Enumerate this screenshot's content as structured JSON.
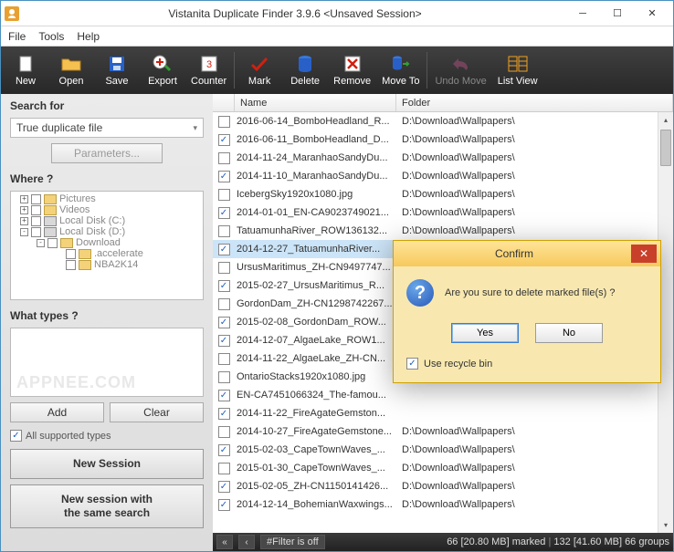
{
  "title": "Vistanita Duplicate Finder 3.9.6 <Unsaved Session>",
  "menu": {
    "file": "File",
    "tools": "Tools",
    "help": "Help"
  },
  "toolbar": [
    {
      "label": "New",
      "icon": "new",
      "color": "#ffffff"
    },
    {
      "label": "Open",
      "icon": "open",
      "color": "#f0b030"
    },
    {
      "label": "Save",
      "icon": "save",
      "color": "#2060d0"
    },
    {
      "label": "Export",
      "icon": "export",
      "color": "#e84020"
    },
    {
      "label": "Counter",
      "icon": "counter",
      "color": "#ffffff"
    },
    {
      "label": "Mark",
      "icon": "mark",
      "color": "#d02010"
    },
    {
      "label": "Delete",
      "icon": "delete",
      "color": "#2060d0"
    },
    {
      "label": "Remove",
      "icon": "remove",
      "color": "#e03020"
    },
    {
      "label": "Move To",
      "icon": "moveto",
      "color": "#2060d0"
    },
    {
      "label": "Undo Move",
      "icon": "undo",
      "color": "#b05080",
      "disabled": true
    },
    {
      "label": "List View",
      "icon": "listview",
      "color": "#f0a020"
    }
  ],
  "sidebar": {
    "search_for": "Search for",
    "search_type": "True duplicate file",
    "parameters": "Parameters...",
    "where": "Where ?",
    "tree": [
      {
        "indent": 0,
        "toggle": "+",
        "label": "Pictures",
        "type": "folder"
      },
      {
        "indent": 0,
        "toggle": "+",
        "label": "Videos",
        "type": "folder"
      },
      {
        "indent": 0,
        "toggle": "+",
        "label": "Local Disk (C:)",
        "type": "drive"
      },
      {
        "indent": 0,
        "toggle": "-",
        "label": "Local Disk (D:)",
        "type": "drive"
      },
      {
        "indent": 1,
        "toggle": "-",
        "label": "Download",
        "type": "folder"
      },
      {
        "indent": 2,
        "toggle": "",
        "label": ".accelerate",
        "type": "folder"
      },
      {
        "indent": 2,
        "toggle": "",
        "label": "NBA2K14",
        "type": "folder"
      }
    ],
    "what_types": "What types ?",
    "watermark": "APPNEE.COM",
    "add": "Add",
    "clear": "Clear",
    "all_types": "All supported types",
    "new_session": "New Session",
    "new_session_same": "New session with\nthe same search"
  },
  "columns": {
    "name": "Name",
    "folder": "Folder"
  },
  "rows": [
    {
      "checked": false,
      "name": "2016-06-14_BomboHeadland_R...",
      "folder": "D:\\Download\\Wallpapers\\"
    },
    {
      "checked": true,
      "name": "2016-06-11_BomboHeadland_D...",
      "folder": "D:\\Download\\Wallpapers\\"
    },
    {
      "checked": false,
      "name": "2014-11-24_MaranhaoSandyDu...",
      "folder": "D:\\Download\\Wallpapers\\"
    },
    {
      "checked": true,
      "name": "2014-11-10_MaranhaoSandyDu...",
      "folder": "D:\\Download\\Wallpapers\\"
    },
    {
      "checked": false,
      "name": "IcebergSky1920x1080.jpg",
      "folder": "D:\\Download\\Wallpapers\\"
    },
    {
      "checked": true,
      "name": "2014-01-01_EN-CA9023749021...",
      "folder": "D:\\Download\\Wallpapers\\"
    },
    {
      "checked": false,
      "name": "TatuamunhaRiver_ROW136132...",
      "folder": "D:\\Download\\Wallpapers\\"
    },
    {
      "checked": true,
      "name": "2014-12-27_TatuamunhaRiver...",
      "folder": "",
      "sel": true
    },
    {
      "checked": false,
      "name": "UrsusMaritimus_ZH-CN9497747...",
      "folder": ""
    },
    {
      "checked": true,
      "name": "2015-02-27_UrsusMaritimus_R...",
      "folder": ""
    },
    {
      "checked": false,
      "name": "GordonDam_ZH-CN1298742267...",
      "folder": ""
    },
    {
      "checked": true,
      "name": "2015-02-08_GordonDam_ROW...",
      "folder": ""
    },
    {
      "checked": true,
      "name": "2014-12-07_AlgaeLake_ROW1...",
      "folder": ""
    },
    {
      "checked": false,
      "name": "2014-11-22_AlgaeLake_ZH-CN...",
      "folder": ""
    },
    {
      "checked": false,
      "name": "OntarioStacks1920x1080.jpg",
      "folder": ""
    },
    {
      "checked": true,
      "name": "EN-CA7451066324_The-famou...",
      "folder": ""
    },
    {
      "checked": true,
      "name": "2014-11-22_FireAgateGemston...",
      "folder": ""
    },
    {
      "checked": false,
      "name": "2014-10-27_FireAgateGemstone...",
      "folder": "D:\\Download\\Wallpapers\\"
    },
    {
      "checked": true,
      "name": "2015-02-03_CapeTownWaves_...",
      "folder": "D:\\Download\\Wallpapers\\"
    },
    {
      "checked": false,
      "name": "2015-01-30_CapeTownWaves_...",
      "folder": "D:\\Download\\Wallpapers\\"
    },
    {
      "checked": true,
      "name": "2015-02-05_ZH-CN1150141426...",
      "folder": "D:\\Download\\Wallpapers\\"
    },
    {
      "checked": true,
      "name": "2014-12-14_BohemianWaxwings...",
      "folder": "D:\\Download\\Wallpapers\\"
    }
  ],
  "status": {
    "filter": "#Filter is off",
    "marked": "66 [20.80 MB] marked",
    "groups": "132 [41.60 MB] 66 groups"
  },
  "dialog": {
    "title": "Confirm",
    "msg": "Are you sure to delete marked file(s) ?",
    "yes": "Yes",
    "no": "No",
    "recycle": "Use recycle bin",
    "recycle_checked": true
  }
}
